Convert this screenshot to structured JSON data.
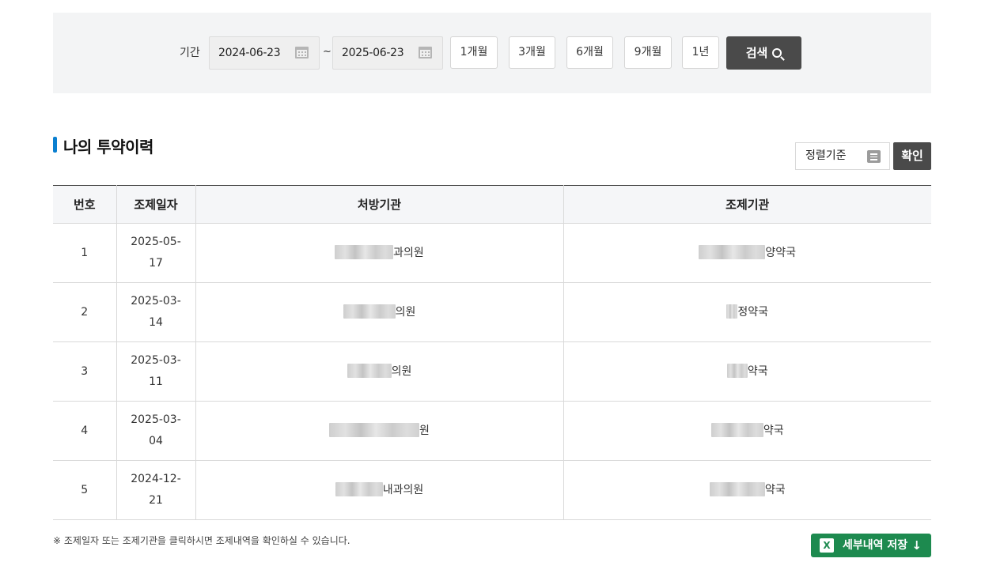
{
  "filter": {
    "period_label": "기간",
    "start_date": "2024-06-23",
    "end_date": "2025-06-23",
    "separator": "~",
    "quick_periods": [
      "1개월",
      "3개월",
      "6개월",
      "9개월",
      "1년"
    ],
    "search_label": "검색"
  },
  "section": {
    "title": "나의 투약이력",
    "sort_label": "정렬기준",
    "confirm_label": "확인"
  },
  "table": {
    "headers": [
      "번호",
      "조제일자",
      "처방기관",
      "조제기관"
    ],
    "rows": [
      {
        "no": "1",
        "date": "2025-05-17",
        "prescriber_suffix": "과의원",
        "pharmacy_suffix": "양약국"
      },
      {
        "no": "2",
        "date": "2025-03-14",
        "prescriber_suffix": "의원",
        "pharmacy_suffix": "정약국"
      },
      {
        "no": "3",
        "date": "2025-03-11",
        "prescriber_suffix": "의원",
        "pharmacy_suffix": "약국"
      },
      {
        "no": "4",
        "date": "2025-03-04",
        "prescriber_suffix": "원",
        "pharmacy_suffix": "약국"
      },
      {
        "no": "5",
        "date": "2024-12-21",
        "prescriber_suffix": "내과의원",
        "pharmacy_suffix": "약국"
      }
    ]
  },
  "footer": {
    "note": "※ 조제일자 또는 조제기관을 클릭하시면 조제내역을 확인하실 수 있습니다.",
    "excel_label": "세부내역 저장",
    "excel_icon": "excel-icon",
    "download_icon": "arrow-down-icon"
  },
  "colors": {
    "accent": "#0a7fd0",
    "dark_button": "#4a4a4a",
    "excel_green": "#1d8a4f",
    "filter_bg": "#f3f4f5"
  }
}
